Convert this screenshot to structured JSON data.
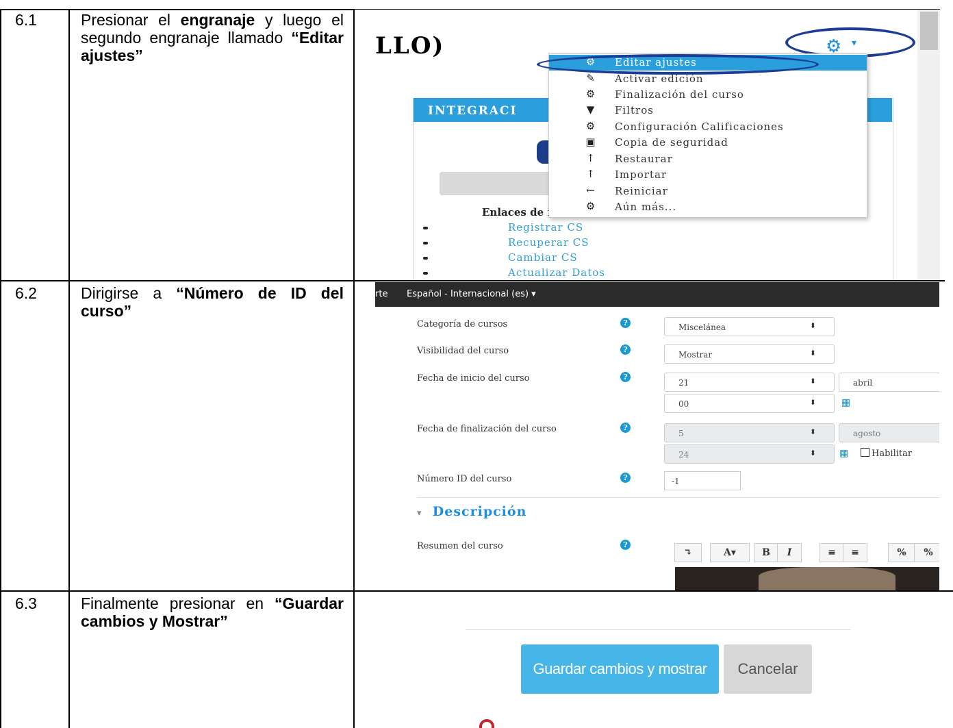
{
  "rows": [
    {
      "num": "6.1",
      "text_parts": [
        "Presionar el ",
        "engranaje",
        " y luego el segundo engranaje llamado ",
        "“Editar ajustes”"
      ]
    },
    {
      "num": "6.2",
      "text_parts": [
        "Dirigirse a ",
        "“Número de ID del curso”"
      ]
    },
    {
      "num": "6.3",
      "text_parts": [
        "Finalmente presionar en ",
        "“Guardar cambios y Mostrar”"
      ]
    }
  ],
  "screen1": {
    "course_title": "LLO)",
    "gear_icon": "gear-icon",
    "sidebar_header": "INTEGRACI",
    "menu": [
      {
        "label": "Editar ajustes",
        "icon": "gear-icon"
      },
      {
        "label": "Activar edición",
        "icon": "pencil-icon"
      },
      {
        "label": "Finalización del curso",
        "icon": "gear-icon"
      },
      {
        "label": "Filtros",
        "icon": "filter-icon"
      },
      {
        "label": "Configuración Calificaciones",
        "icon": "gear-icon"
      },
      {
        "label": "Copia de seguridad",
        "icon": "save-icon"
      },
      {
        "label": "Restaurar",
        "icon": "upload-icon"
      },
      {
        "label": "Importar",
        "icon": "upload-icon"
      },
      {
        "label": "Reiniciar",
        "icon": "arrow-left-icon"
      },
      {
        "label": "Aún más...",
        "icon": "gear-icon"
      }
    ],
    "links_heading": "Enlaces de interés",
    "links": [
      "Registrar CS",
      "Recuperar CS",
      "Cambiar CS",
      "Actualizar Datos"
    ],
    "accent_color": "#2a9fdc"
  },
  "screen2": {
    "nav_prefix": "rte",
    "language": "Español - Internacional (es)",
    "fields": {
      "categoria": {
        "label": "Categoría de cursos",
        "value": "Miscelánea"
      },
      "visibilidad": {
        "label": "Visibilidad del curso",
        "value": "Mostrar"
      },
      "inicio": {
        "label": "Fecha de inicio del curso",
        "day": "21",
        "month": "abril",
        "minute": "00"
      },
      "fin": {
        "label": "Fecha de finalización del curso",
        "day": "5",
        "month": "agosto",
        "hour": "24",
        "enable_label": "Habilitar"
      },
      "idnumber": {
        "label": "Número ID del curso",
        "value": "-1"
      },
      "resumen": {
        "label": "Resumen del curso"
      }
    },
    "section_heading": "Descripción",
    "toolbar": [
      "↴",
      "A▾",
      "B",
      "I"
    ]
  },
  "screen3": {
    "save_label": "Guardar cambios y mostrar",
    "cancel_label": "Cancelar"
  }
}
